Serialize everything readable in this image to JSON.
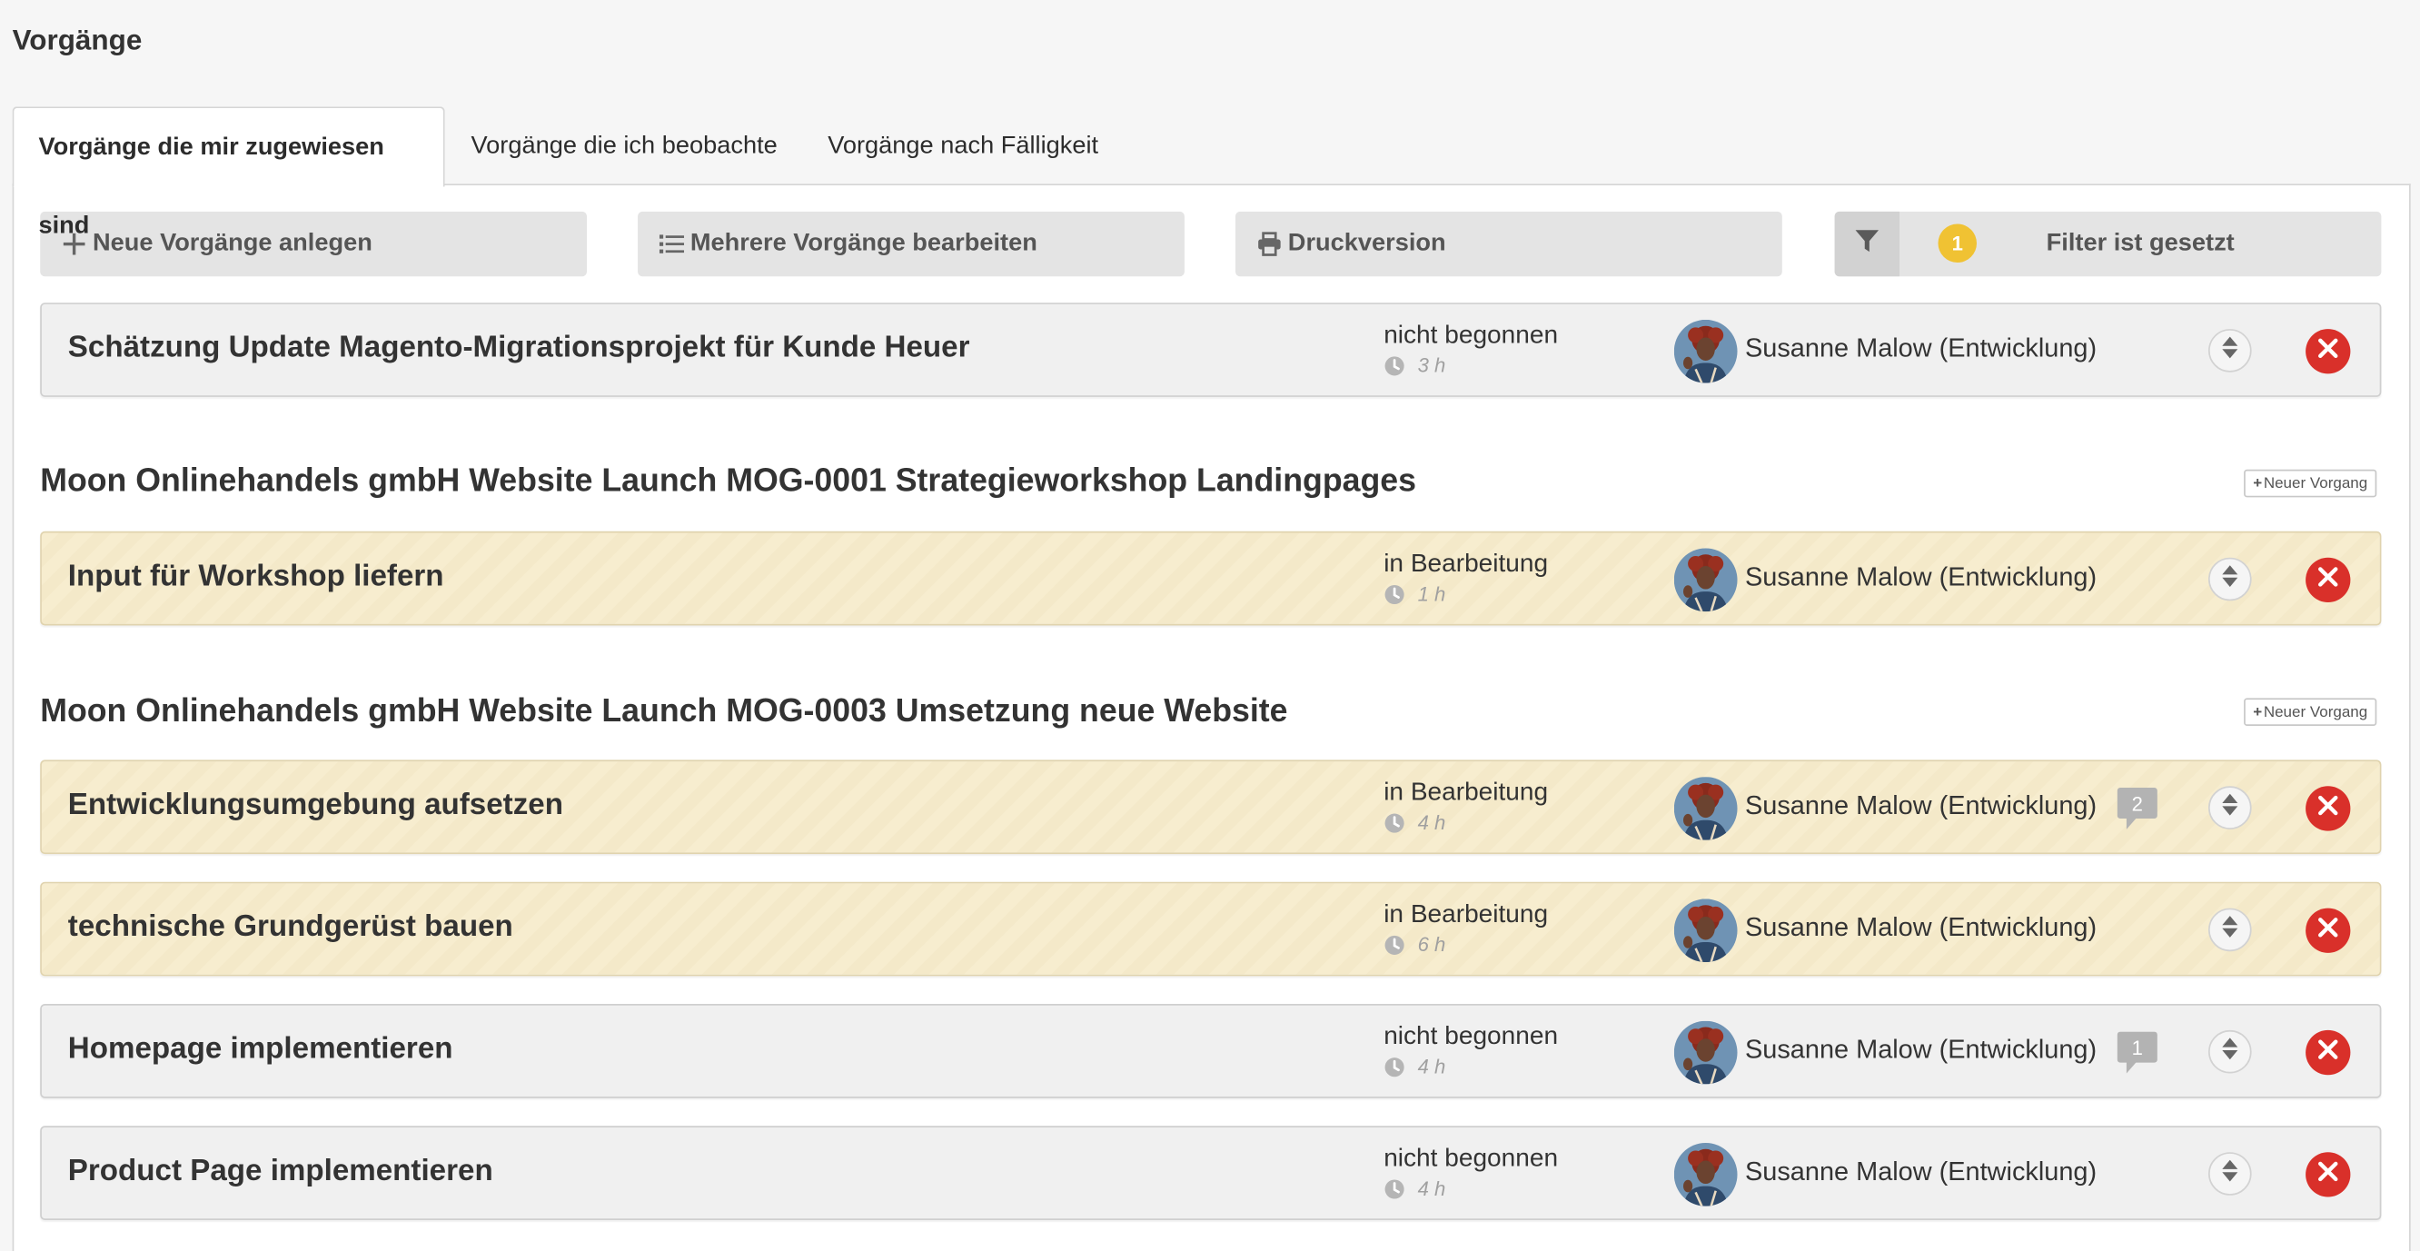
{
  "page": {
    "title": "Vorgänge"
  },
  "tabs": [
    {
      "label": "Vorgänge die mir zugewiesen sind",
      "active": true
    },
    {
      "label": "Vorgänge die ich beobachte",
      "active": false
    },
    {
      "label": "Vorgänge nach Fälligkeit",
      "active": false
    }
  ],
  "toolbar": {
    "new_label": "Neue Vorgänge anlegen",
    "bulk_label": "Mehrere Vorgänge bearbeiten",
    "print_label": "Druckversion",
    "filter_count": "1",
    "filter_label": "Filter ist gesetzt"
  },
  "groups": [
    {
      "title": "Moon Onlinehandels gmbH Website Launch MOG-0001 Strategieworkshop Landingpages",
      "new_label": "Neuer Vorgang"
    },
    {
      "title": "Moon Onlinehandels gmbH Website Launch MOG-0003 Umsetzung neue Website",
      "new_label": "Neuer Vorgang"
    }
  ],
  "tasks": [
    {
      "title": "Schätzung Update Magento-Migrationsprojekt für Kunde Heuer",
      "status": "nicht begonnen",
      "time": "3 h",
      "assignee": "Susanne Malow (Entwicklung)",
      "comments": ""
    },
    {
      "title": "Input für Workshop liefern",
      "status": "in Bearbeitung",
      "time": "1 h",
      "assignee": "Susanne Malow (Entwicklung)",
      "comments": ""
    },
    {
      "title": "Entwicklungsumgebung aufsetzen",
      "status": "in Bearbeitung",
      "time": "4 h",
      "assignee": "Susanne Malow (Entwicklung)",
      "comments": "2"
    },
    {
      "title": "technische Grundgerüst bauen",
      "status": "in Bearbeitung",
      "time": "6 h",
      "assignee": "Susanne Malow (Entwicklung)",
      "comments": ""
    },
    {
      "title": "Homepage implementieren",
      "status": "nicht begonnen",
      "time": "4 h",
      "assignee": "Susanne Malow (Entwicklung)",
      "comments": "1"
    },
    {
      "title": "Product Page implementieren",
      "status": "nicht begonnen",
      "time": "4 h",
      "assignee": "Susanne Malow (Entwicklung)",
      "comments": ""
    }
  ],
  "colors": {
    "status_in_progress_bg": "#f7edcf",
    "status_not_started_bg": "#f0f0f0",
    "delete_red": "#d9302a",
    "filter_badge": "#f0c233",
    "comment_bubble": "#b3b3b3"
  },
  "icons": {
    "plus": "plus-icon",
    "list": "list-icon",
    "print": "printer-icon",
    "filter": "filter-icon",
    "clock": "clock-icon",
    "comment": "comment-icon",
    "sort": "sort-icon",
    "delete": "close-icon"
  }
}
